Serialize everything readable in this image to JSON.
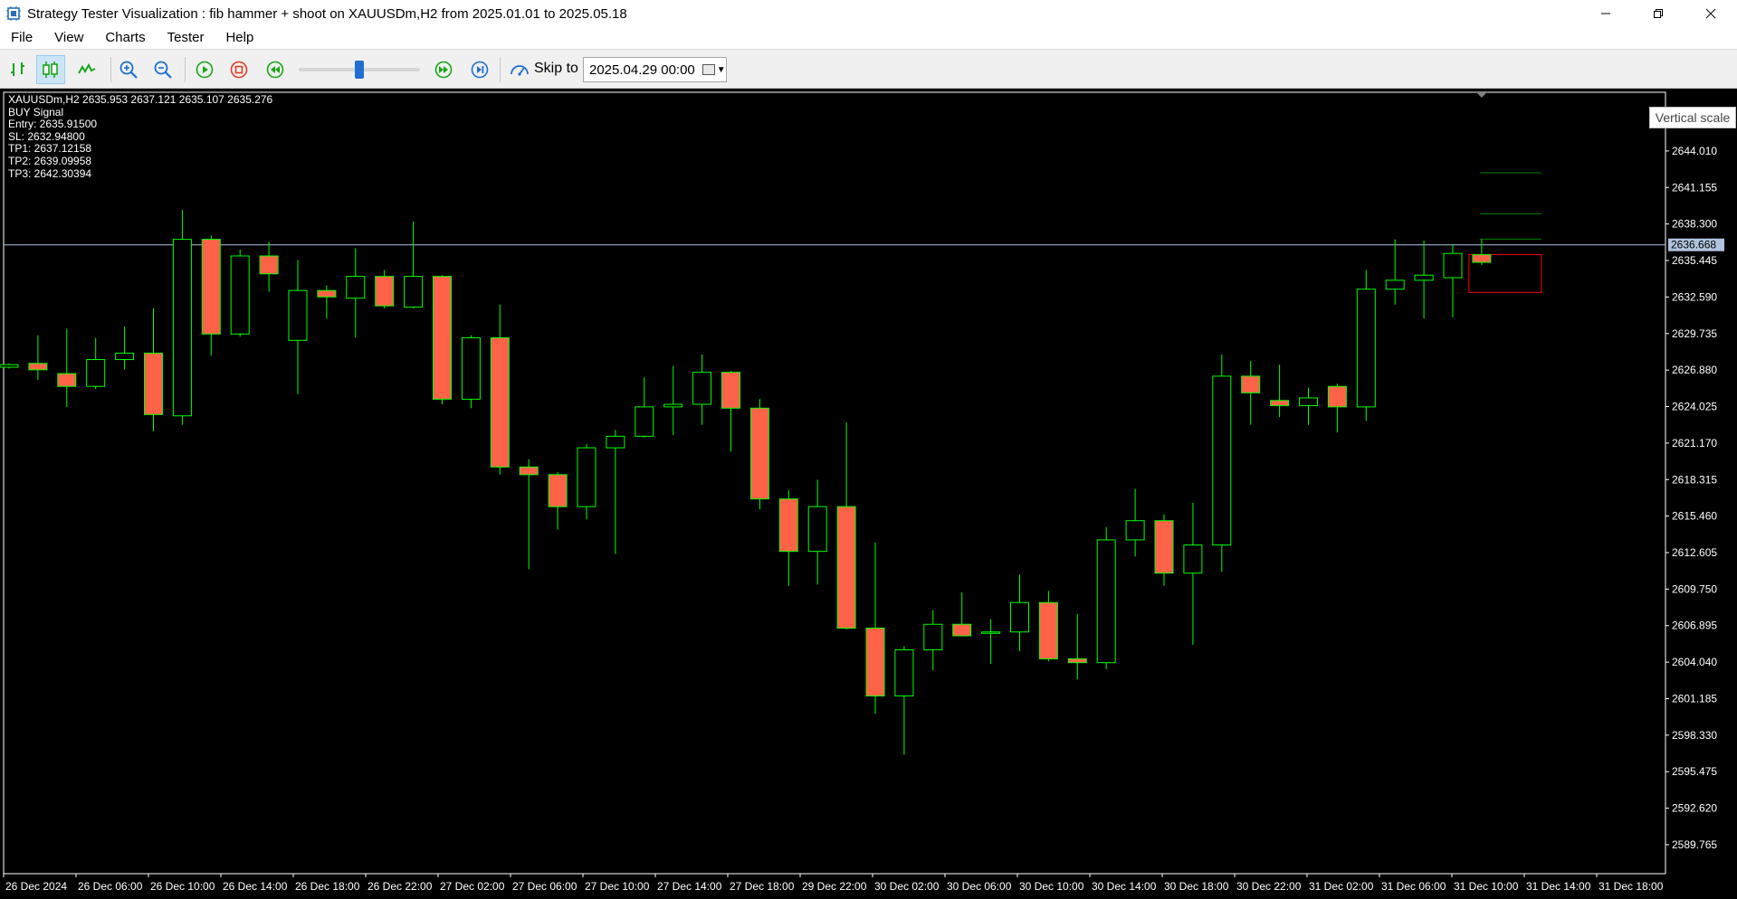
{
  "window": {
    "title": "Strategy Tester Visualization :  fib hammer + shoot on XAUUSDm,H2 from 2025.01.01 to 2025.05.18"
  },
  "menu": [
    "File",
    "View",
    "Charts",
    "Tester",
    "Help"
  ],
  "toolbar": {
    "skip_label": "Skip to",
    "skip_date": "2025.04.29 00:00",
    "slider_value": 0.5
  },
  "chart_info": {
    "symbol_line": "XAUUSDm,H2  2635.953 2637.121 2635.107 2635.276",
    "signal": "BUY Signal",
    "entry": "Entry: 2635.91500",
    "sl": "SL: 2632.94800",
    "tp1": "TP1: 2637.12158",
    "tp2": "TP2: 2639.09958",
    "tp3": "TP3: 2642.30394"
  },
  "tooltip": "Vertical scale",
  "colors": {
    "bull": "#00ff00",
    "bear_fill": "#ff6347",
    "background": "#000000",
    "axis": "#ffffff",
    "price_line": "#b0c4de",
    "sl_box": "#ff0000",
    "tp_lines": "#008000"
  },
  "chart_data": {
    "type": "candlestick",
    "y_ticks": [
      2646.865,
      2644.01,
      2641.155,
      2638.3,
      2635.445,
      2632.59,
      2629.735,
      2626.88,
      2624.025,
      2621.17,
      2618.315,
      2615.46,
      2612.605,
      2609.75,
      2606.895,
      2604.04,
      2601.185,
      2598.33,
      2595.475,
      2592.62,
      2589.765
    ],
    "y_tick_labels": [
      "2646.865",
      "2644.010",
      "2641.155",
      "2638.300",
      "2635.445",
      "2632.590",
      "2629.735",
      "2626.880",
      "2624.025",
      "2621.170",
      "2618.315",
      "2615.460",
      "2612.605",
      "2609.750",
      "2606.895",
      "2604.040",
      "2601.185",
      "2598.330",
      "2595.475",
      "2592.620",
      "2589.765"
    ],
    "ylim": [
      2587.5,
      2648.6
    ],
    "current_price": 2636.668,
    "current_price_label": "2636.668",
    "x_tick_labels": [
      "26 Dec 2024",
      "26 Dec 06:00",
      "26 Dec 10:00",
      "26 Dec 14:00",
      "26 Dec 18:00",
      "26 Dec 22:00",
      "27 Dec 02:00",
      "27 Dec 06:00",
      "27 Dec 10:00",
      "27 Dec 14:00",
      "27 Dec 18:00",
      "29 Dec 22:00",
      "30 Dec 02:00",
      "30 Dec 06:00",
      "30 Dec 10:00",
      "30 Dec 14:00",
      "30 Dec 18:00",
      "30 Dec 22:00",
      "31 Dec 02:00",
      "31 Dec 06:00",
      "31 Dec 10:00",
      "31 Dec 14:00",
      "31 Dec 18:00"
    ],
    "candles": [
      {
        "o": 2627.1,
        "h": 2627.4,
        "l": 2627.0,
        "c": 2627.3
      },
      {
        "o": 2627.4,
        "h": 2629.6,
        "l": 2626.1,
        "c": 2626.9
      },
      {
        "o": 2626.6,
        "h": 2630.1,
        "l": 2624.0,
        "c": 2625.6
      },
      {
        "o": 2625.6,
        "h": 2629.4,
        "l": 2625.4,
        "c": 2627.7
      },
      {
        "o": 2627.7,
        "h": 2630.3,
        "l": 2626.9,
        "c": 2628.2
      },
      {
        "o": 2628.2,
        "h": 2631.7,
        "l": 2622.1,
        "c": 2623.4
      },
      {
        "o": 2623.3,
        "h": 2639.4,
        "l": 2622.6,
        "c": 2637.1
      },
      {
        "o": 2637.1,
        "h": 2637.4,
        "l": 2628.0,
        "c": 2629.7
      },
      {
        "o": 2629.7,
        "h": 2636.3,
        "l": 2629.5,
        "c": 2635.8
      },
      {
        "o": 2635.8,
        "h": 2636.9,
        "l": 2633.0,
        "c": 2634.4
      },
      {
        "o": 2629.2,
        "h": 2635.5,
        "l": 2625.0,
        "c": 2633.1
      },
      {
        "o": 2633.1,
        "h": 2633.5,
        "l": 2630.9,
        "c": 2632.6
      },
      {
        "o": 2632.5,
        "h": 2636.4,
        "l": 2629.4,
        "c": 2634.2
      },
      {
        "o": 2634.2,
        "h": 2634.7,
        "l": 2631.7,
        "c": 2631.9
      },
      {
        "o": 2631.8,
        "h": 2638.5,
        "l": 2631.7,
        "c": 2634.2
      },
      {
        "o": 2634.2,
        "h": 2634.3,
        "l": 2624.2,
        "c": 2624.6
      },
      {
        "o": 2624.6,
        "h": 2629.6,
        "l": 2623.9,
        "c": 2629.4
      },
      {
        "o": 2629.4,
        "h": 2632.0,
        "l": 2618.7,
        "c": 2619.3
      },
      {
        "o": 2619.3,
        "h": 2619.9,
        "l": 2611.3,
        "c": 2618.7
      },
      {
        "o": 2618.7,
        "h": 2618.9,
        "l": 2614.4,
        "c": 2616.2
      },
      {
        "o": 2616.2,
        "h": 2621.1,
        "l": 2615.2,
        "c": 2620.8
      },
      {
        "o": 2620.8,
        "h": 2622.2,
        "l": 2612.5,
        "c": 2621.7
      },
      {
        "o": 2621.7,
        "h": 2626.3,
        "l": 2621.6,
        "c": 2624.0
      },
      {
        "o": 2624.0,
        "h": 2627.2,
        "l": 2621.8,
        "c": 2624.2
      },
      {
        "o": 2624.2,
        "h": 2628.1,
        "l": 2622.6,
        "c": 2626.7
      },
      {
        "o": 2626.7,
        "h": 2626.8,
        "l": 2620.5,
        "c": 2623.9
      },
      {
        "o": 2623.9,
        "h": 2624.6,
        "l": 2616.0,
        "c": 2616.8
      },
      {
        "o": 2616.8,
        "h": 2617.5,
        "l": 2610.0,
        "c": 2612.7
      },
      {
        "o": 2612.7,
        "h": 2618.3,
        "l": 2610.1,
        "c": 2616.2
      },
      {
        "o": 2616.2,
        "h": 2622.8,
        "l": 2606.6,
        "c": 2606.7
      },
      {
        "o": 2606.7,
        "h": 2613.4,
        "l": 2600.0,
        "c": 2601.4
      },
      {
        "o": 2601.4,
        "h": 2605.3,
        "l": 2596.8,
        "c": 2605.0
      },
      {
        "o": 2605.0,
        "h": 2608.1,
        "l": 2603.4,
        "c": 2607.0
      },
      {
        "o": 2607.0,
        "h": 2609.5,
        "l": 2606.1,
        "c": 2606.1
      },
      {
        "o": 2606.4,
        "h": 2607.4,
        "l": 2603.9,
        "c": 2606.4
      },
      {
        "o": 2606.4,
        "h": 2610.9,
        "l": 2604.9,
        "c": 2608.7
      },
      {
        "o": 2608.7,
        "h": 2609.6,
        "l": 2604.1,
        "c": 2604.3
      },
      {
        "o": 2604.3,
        "h": 2607.8,
        "l": 2602.7,
        "c": 2604.0
      },
      {
        "o": 2604.0,
        "h": 2614.6,
        "l": 2603.5,
        "c": 2613.6
      },
      {
        "o": 2613.6,
        "h": 2617.6,
        "l": 2612.3,
        "c": 2615.1
      },
      {
        "o": 2615.1,
        "h": 2615.6,
        "l": 2610.0,
        "c": 2611.0
      },
      {
        "o": 2611.0,
        "h": 2616.5,
        "l": 2605.4,
        "c": 2613.2
      },
      {
        "o": 2613.2,
        "h": 2628.1,
        "l": 2611.1,
        "c": 2626.4
      },
      {
        "o": 2626.4,
        "h": 2627.6,
        "l": 2622.6,
        "c": 2625.1
      },
      {
        "o": 2624.5,
        "h": 2627.3,
        "l": 2623.2,
        "c": 2624.1
      },
      {
        "o": 2624.1,
        "h": 2625.5,
        "l": 2622.6,
        "c": 2624.7
      },
      {
        "o": 2625.6,
        "h": 2625.8,
        "l": 2622.0,
        "c": 2624.0
      },
      {
        "o": 2624.0,
        "h": 2634.7,
        "l": 2622.9,
        "c": 2633.2
      },
      {
        "o": 2633.2,
        "h": 2637.1,
        "l": 2632.0,
        "c": 2633.9
      },
      {
        "o": 2633.9,
        "h": 2637.0,
        "l": 2630.9,
        "c": 2634.3
      },
      {
        "o": 2634.1,
        "h": 2636.7,
        "l": 2631.0,
        "c": 2636.0
      },
      {
        "o": 2635.9,
        "h": 2637.1,
        "l": 2635.1,
        "c": 2635.3
      }
    ],
    "levels": {
      "entry": 2635.915,
      "sl": 2632.948,
      "tp1": 2637.12158,
      "tp2": 2639.09958,
      "tp3": 2642.30394
    }
  }
}
